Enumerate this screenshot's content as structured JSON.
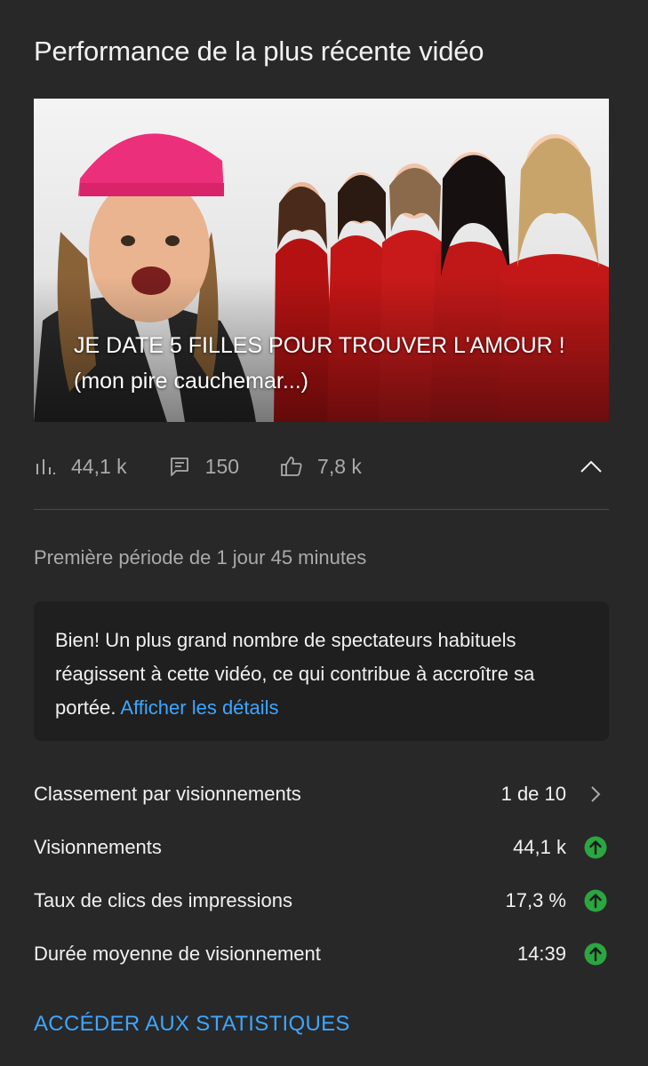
{
  "header": {
    "title": "Performance de la plus récente vidéo"
  },
  "video": {
    "thumbnail_caption": "JE DATE 5 FILLES POUR TROUVER L'AMOUR ! (mon pire cauchemar...)"
  },
  "stats": {
    "views": {
      "icon": "bar-chart-icon",
      "value": "44,1 k"
    },
    "comments": {
      "icon": "comment-icon",
      "value": "150"
    },
    "likes": {
      "icon": "thumbs-up-icon",
      "value": "7,8 k"
    },
    "toggle_icon": "chevron-up-icon"
  },
  "period": {
    "text": "Première période de 1 jour 45 minutes"
  },
  "notice": {
    "text": "Bien! Un plus grand nombre de spectateurs habituels réagissent à cette vidéo, ce qui contribue à accroître sa portée.",
    "link": "Afficher les détails"
  },
  "metrics": [
    {
      "label": "Classement par visionnements",
      "value": "1 de 10",
      "indicator": "chevron-right-icon"
    },
    {
      "label": "Visionnements",
      "value": "44,1 k",
      "indicator": "trend-up-icon"
    },
    {
      "label": "Taux de clics des impressions",
      "value": "17,3 %",
      "indicator": "trend-up-icon"
    },
    {
      "label": "Durée moyenne de visionnement",
      "value": "14:39",
      "indicator": "trend-up-icon"
    }
  ],
  "cta": {
    "label": "ACCÉDER AUX STATISTIQUES"
  },
  "colors": {
    "background": "#282828",
    "notice_background": "#1f1f1f",
    "link": "#3ea6ff",
    "trend_up": "#2ba640",
    "muted_text": "#aaaaaa"
  }
}
